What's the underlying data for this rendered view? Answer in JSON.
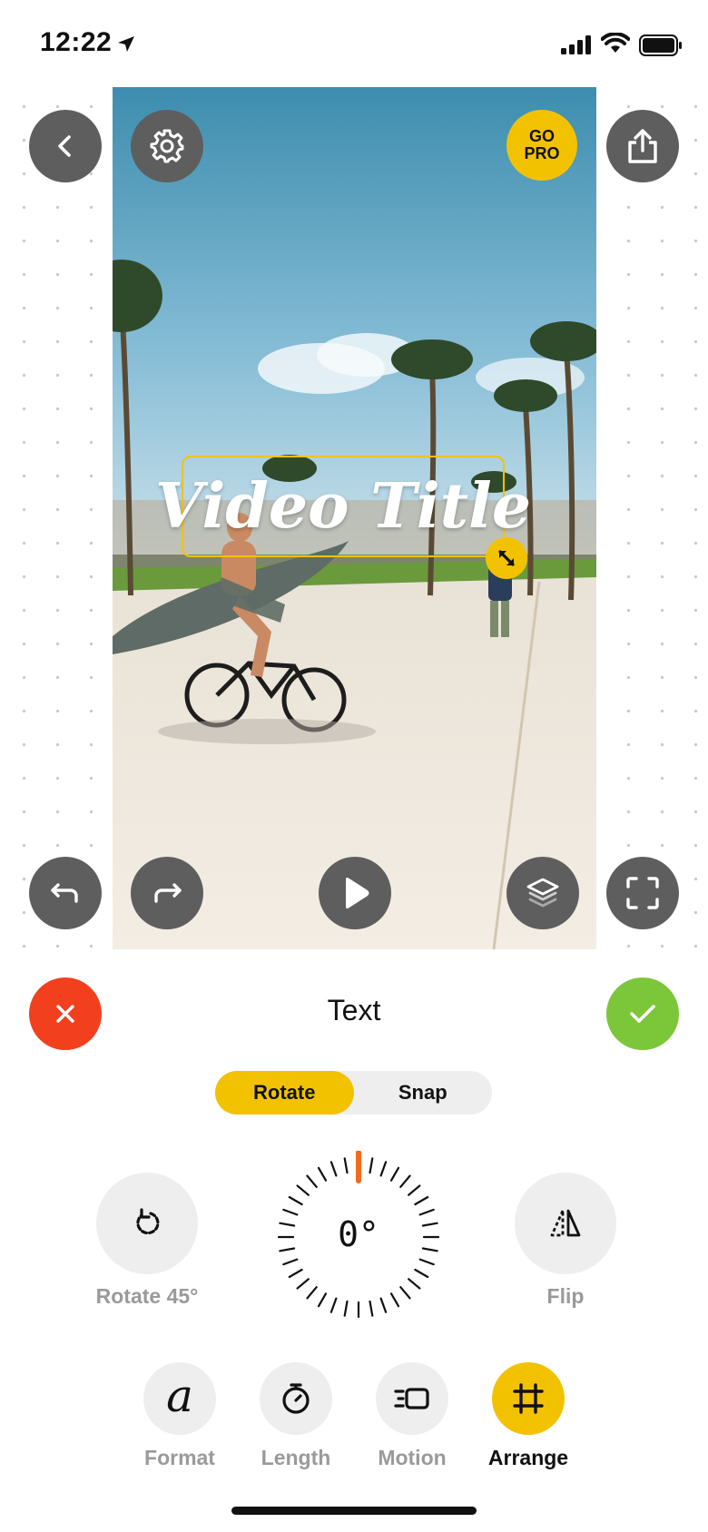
{
  "status_bar": {
    "time": "12:22",
    "icons": [
      "location-arrow-icon",
      "cellular-signal-icon",
      "wifi-icon",
      "battery-icon"
    ]
  },
  "canvas": {
    "top_buttons": [
      "back-icon",
      "gear-icon",
      "share-icon"
    ],
    "go_pro": {
      "line1": "GO",
      "line2": "PRO"
    },
    "bottom_buttons": [
      "undo-icon",
      "redo-icon",
      "play-icon",
      "layers-icon",
      "fullscreen-icon"
    ],
    "text_overlay": {
      "text": "Video Title"
    }
  },
  "panel": {
    "title": "Text",
    "segments": [
      {
        "label": "Rotate",
        "active": true
      },
      {
        "label": "Snap",
        "active": false
      }
    ],
    "rotate45_label": "Rotate 45°",
    "flip_label": "Flip",
    "dial_value": "0°"
  },
  "tabs": [
    {
      "label": "Format",
      "icon": "format-script-a-icon",
      "active": false
    },
    {
      "label": "Length",
      "icon": "stopwatch-icon",
      "active": false
    },
    {
      "label": "Motion",
      "icon": "motion-icon",
      "active": false
    },
    {
      "label": "Arrange",
      "icon": "crop-frame-icon",
      "active": true
    }
  ],
  "colors": {
    "accent": "#f2c200",
    "cancel": "#f2401e",
    "confirm": "#7cc63a",
    "button_dark": "#5e5e5e",
    "dial_marker": "#f26a1b"
  }
}
